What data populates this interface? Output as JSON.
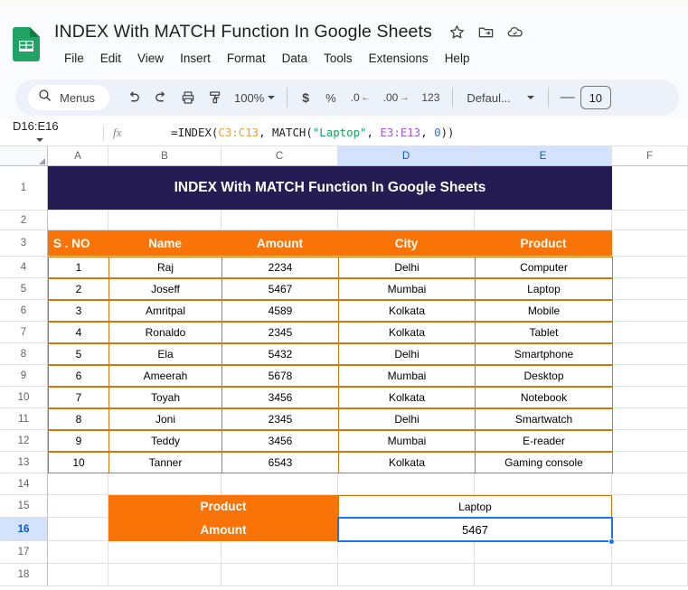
{
  "app": {
    "logo_icon": "google-sheets-logo",
    "doc_title": "INDEX With MATCH Function  In Google Sheets",
    "title_icons": [
      {
        "name": "star-icon",
        "label": "Star"
      },
      {
        "name": "move-to-folder-icon",
        "label": "Move"
      },
      {
        "name": "cloud-saved-icon",
        "label": "Saved to Drive"
      }
    ],
    "menus": [
      "File",
      "Edit",
      "View",
      "Insert",
      "Format",
      "Data",
      "Tools",
      "Extensions",
      "Help"
    ]
  },
  "toolbar": {
    "search_icon": "search-icon",
    "menus_label": "Menus",
    "undo_icon": "undo-icon",
    "redo_icon": "redo-icon",
    "print_icon": "print-icon",
    "paint_format_icon": "paint-format-icon",
    "zoom_value": "100%",
    "currency_label": "$",
    "percent_label": "%",
    "decrease_decimal_label": ".0",
    "increase_decimal_label": ".00",
    "more_formats_label": "123",
    "font_family": "Defaul...",
    "font_decrease_label": "—",
    "font_size": "10"
  },
  "formula_bar": {
    "name_box": "D16:E16",
    "fx_label": "fx",
    "formula_parts": [
      {
        "text": "=INDEX(",
        "type": "plain"
      },
      {
        "text": "C3:C13",
        "type": "ref1"
      },
      {
        "text": ", MATCH(",
        "type": "plain"
      },
      {
        "text": "\"Laptop\"",
        "type": "string"
      },
      {
        "text": ", ",
        "type": "plain"
      },
      {
        "text": "E3:E13",
        "type": "ref2"
      },
      {
        "text": ", ",
        "type": "plain"
      },
      {
        "text": "0",
        "type": "number"
      },
      {
        "text": "))",
        "type": "plain"
      }
    ],
    "formula_text": "=INDEX(C3:C13, MATCH(\"Laptop\", E3:E13, 0))"
  },
  "grid": {
    "columns": [
      "A",
      "B",
      "C",
      "D",
      "E",
      "F"
    ],
    "selected_columns": [
      "D",
      "E"
    ],
    "rows": [
      "1",
      "2",
      "3",
      "4",
      "5",
      "6",
      "7",
      "8",
      "9",
      "10",
      "11",
      "12",
      "13",
      "14",
      "15",
      "16",
      "17",
      "18"
    ],
    "selected_row": "16",
    "banner_title": "INDEX With MATCH Function  In Google Sheets",
    "table_headers": [
      "S . NO",
      "Name",
      "Amount",
      "City",
      "Product"
    ],
    "table_rows": [
      [
        "1",
        "Raj",
        "2234",
        "Delhi",
        "Computer"
      ],
      [
        "2",
        "Joseff",
        "5467",
        "Mumbai",
        "Laptop"
      ],
      [
        "3",
        "Amritpal",
        "4589",
        "Kolkata",
        "Mobile"
      ],
      [
        "4",
        "Ronaldo",
        "2345",
        "Kolkata",
        "Tablet"
      ],
      [
        "5",
        "Ela",
        "5432",
        "Delhi",
        "Smartphone"
      ],
      [
        "6",
        "Ameerah",
        "5678",
        "Mumbai",
        "Desktop"
      ],
      [
        "7",
        "Toyah",
        "3456",
        "Kolkata",
        "Notebook"
      ],
      [
        "8",
        "Joni",
        "2345",
        "Delhi",
        "Smartwatch"
      ],
      [
        "9",
        "Teddy",
        "3456",
        "Mumbai",
        "E-reader"
      ],
      [
        "10",
        "Tanner",
        "6543",
        "Kolkata",
        "Gaming console"
      ]
    ],
    "lookup": {
      "product_label": "Product",
      "product_value": "Laptop",
      "amount_label": "Amount",
      "amount_value": "5467"
    }
  },
  "colors": {
    "navy": "#241c52",
    "orange": "#f97306",
    "orange_border": "#d4760e",
    "selection_blue": "#1a73e8",
    "header_selected": "#d3e3fd"
  }
}
